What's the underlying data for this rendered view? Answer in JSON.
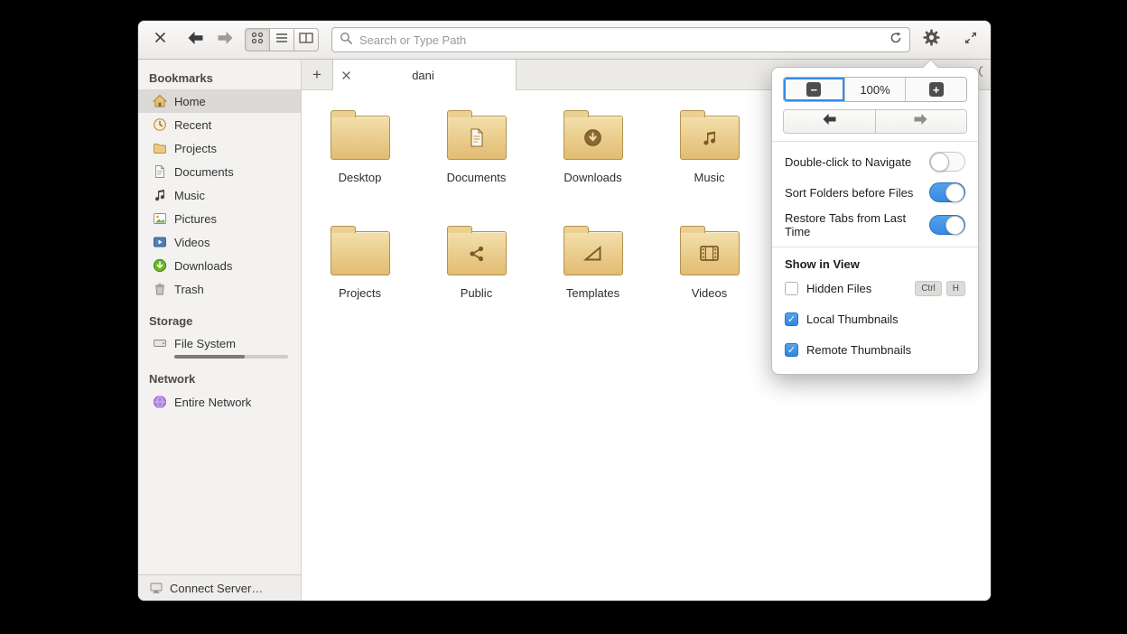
{
  "toolbar": {
    "search_placeholder": "Search or Type Path",
    "icons": [
      "close-icon",
      "back-arrow-icon",
      "forward-arrow-icon",
      "grid-view-icon",
      "list-view-icon",
      "column-view-icon",
      "search-icon",
      "refresh-icon",
      "gear-icon",
      "expand-icon"
    ]
  },
  "tabbar": {
    "active_tab": "dani",
    "new_tab_symbol": "+"
  },
  "sidebar": {
    "sections": {
      "bookmarks": "Bookmarks",
      "storage": "Storage",
      "network": "Network"
    },
    "bookmarks_items": [
      {
        "label": "Home",
        "icon": "home-icon",
        "selected": true
      },
      {
        "label": "Recent",
        "icon": "clock-icon"
      },
      {
        "label": "Projects",
        "icon": "folder-icon"
      },
      {
        "label": "Documents",
        "icon": "document-icon"
      },
      {
        "label": "Music",
        "icon": "music-note-icon"
      },
      {
        "label": "Pictures",
        "icon": "picture-icon"
      },
      {
        "label": "Videos",
        "icon": "video-icon"
      },
      {
        "label": "Downloads",
        "icon": "download-icon"
      },
      {
        "label": "Trash",
        "icon": "trash-icon"
      }
    ],
    "storage_items": [
      {
        "label": "File System",
        "icon": "drive-icon",
        "usage_percent": 62
      }
    ],
    "network_items": [
      {
        "label": "Entire Network",
        "icon": "network-globe-icon"
      }
    ],
    "connect_server": "Connect Server…"
  },
  "files": {
    "items": [
      {
        "name": "Desktop",
        "emblem": "none"
      },
      {
        "name": "Documents",
        "emblem": "document"
      },
      {
        "name": "Downloads",
        "emblem": "download"
      },
      {
        "name": "Music",
        "emblem": "music"
      },
      {
        "name": "Projects",
        "emblem": "none"
      },
      {
        "name": "Public",
        "emblem": "share"
      },
      {
        "name": "Templates",
        "emblem": "template"
      },
      {
        "name": "Videos",
        "emblem": "film"
      }
    ]
  },
  "popover": {
    "zoom_out_symbol": "−",
    "zoom_level": "100%",
    "zoom_in_symbol": "+",
    "double_click_label": "Double-click to Navigate",
    "double_click_state": "off",
    "sort_folders_label": "Sort Folders before Files",
    "sort_folders_state": "on",
    "restore_tabs_label": "Restore Tabs from Last Time",
    "restore_tabs_state": "on",
    "show_in_view_header": "Show in View",
    "hidden_files_label": "Hidden Files",
    "hidden_files_checked": false,
    "shortcut": {
      "key1": "Ctrl",
      "key2": "H"
    },
    "local_thumbnails_label": "Local Thumbnails",
    "local_thumbnails_checked": true,
    "remote_thumbnails_label": "Remote Thumbnails",
    "remote_thumbnails_checked": true,
    "check_symbol": "✓"
  },
  "colors": {
    "accent": "#3689e6",
    "folder": "#e8c87e",
    "toggle_on": "#3689e6"
  }
}
